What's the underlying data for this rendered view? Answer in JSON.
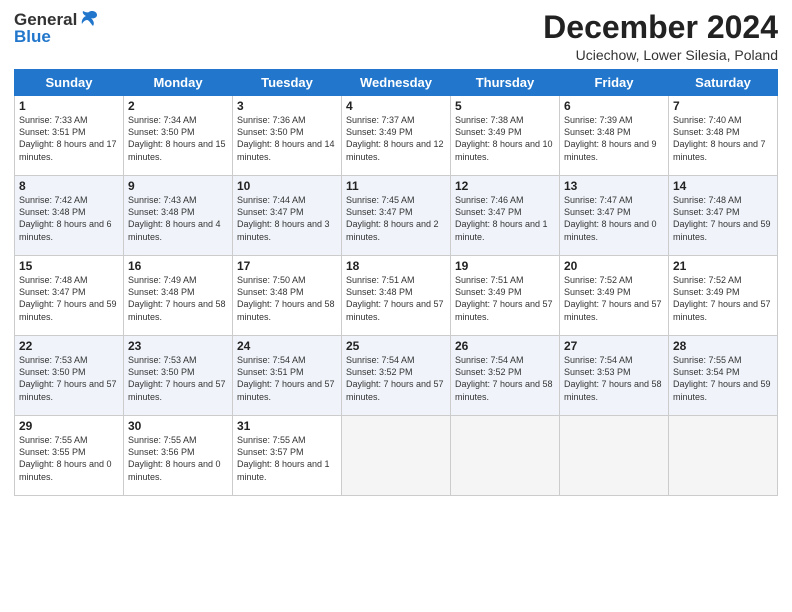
{
  "header": {
    "logo_general": "General",
    "logo_blue": "Blue",
    "month_title": "December 2024",
    "location": "Uciechow, Lower Silesia, Poland"
  },
  "weekdays": [
    "Sunday",
    "Monday",
    "Tuesday",
    "Wednesday",
    "Thursday",
    "Friday",
    "Saturday"
  ],
  "weeks": [
    [
      {
        "day": "1",
        "sunrise": "7:33 AM",
        "sunset": "3:51 PM",
        "daylight": "8 hours and 17 minutes."
      },
      {
        "day": "2",
        "sunrise": "7:34 AM",
        "sunset": "3:50 PM",
        "daylight": "8 hours and 15 minutes."
      },
      {
        "day": "3",
        "sunrise": "7:36 AM",
        "sunset": "3:50 PM",
        "daylight": "8 hours and 14 minutes."
      },
      {
        "day": "4",
        "sunrise": "7:37 AM",
        "sunset": "3:49 PM",
        "daylight": "8 hours and 12 minutes."
      },
      {
        "day": "5",
        "sunrise": "7:38 AM",
        "sunset": "3:49 PM",
        "daylight": "8 hours and 10 minutes."
      },
      {
        "day": "6",
        "sunrise": "7:39 AM",
        "sunset": "3:48 PM",
        "daylight": "8 hours and 9 minutes."
      },
      {
        "day": "7",
        "sunrise": "7:40 AM",
        "sunset": "3:48 PM",
        "daylight": "8 hours and 7 minutes."
      }
    ],
    [
      {
        "day": "8",
        "sunrise": "7:42 AM",
        "sunset": "3:48 PM",
        "daylight": "8 hours and 6 minutes."
      },
      {
        "day": "9",
        "sunrise": "7:43 AM",
        "sunset": "3:48 PM",
        "daylight": "8 hours and 4 minutes."
      },
      {
        "day": "10",
        "sunrise": "7:44 AM",
        "sunset": "3:47 PM",
        "daylight": "8 hours and 3 minutes."
      },
      {
        "day": "11",
        "sunrise": "7:45 AM",
        "sunset": "3:47 PM",
        "daylight": "8 hours and 2 minutes."
      },
      {
        "day": "12",
        "sunrise": "7:46 AM",
        "sunset": "3:47 PM",
        "daylight": "8 hours and 1 minute."
      },
      {
        "day": "13",
        "sunrise": "7:47 AM",
        "sunset": "3:47 PM",
        "daylight": "8 hours and 0 minutes."
      },
      {
        "day": "14",
        "sunrise": "7:48 AM",
        "sunset": "3:47 PM",
        "daylight": "7 hours and 59 minutes."
      }
    ],
    [
      {
        "day": "15",
        "sunrise": "7:48 AM",
        "sunset": "3:47 PM",
        "daylight": "7 hours and 59 minutes."
      },
      {
        "day": "16",
        "sunrise": "7:49 AM",
        "sunset": "3:48 PM",
        "daylight": "7 hours and 58 minutes."
      },
      {
        "day": "17",
        "sunrise": "7:50 AM",
        "sunset": "3:48 PM",
        "daylight": "7 hours and 58 minutes."
      },
      {
        "day": "18",
        "sunrise": "7:51 AM",
        "sunset": "3:48 PM",
        "daylight": "7 hours and 57 minutes."
      },
      {
        "day": "19",
        "sunrise": "7:51 AM",
        "sunset": "3:49 PM",
        "daylight": "7 hours and 57 minutes."
      },
      {
        "day": "20",
        "sunrise": "7:52 AM",
        "sunset": "3:49 PM",
        "daylight": "7 hours and 57 minutes."
      },
      {
        "day": "21",
        "sunrise": "7:52 AM",
        "sunset": "3:49 PM",
        "daylight": "7 hours and 57 minutes."
      }
    ],
    [
      {
        "day": "22",
        "sunrise": "7:53 AM",
        "sunset": "3:50 PM",
        "daylight": "7 hours and 57 minutes."
      },
      {
        "day": "23",
        "sunrise": "7:53 AM",
        "sunset": "3:50 PM",
        "daylight": "7 hours and 57 minutes."
      },
      {
        "day": "24",
        "sunrise": "7:54 AM",
        "sunset": "3:51 PM",
        "daylight": "7 hours and 57 minutes."
      },
      {
        "day": "25",
        "sunrise": "7:54 AM",
        "sunset": "3:52 PM",
        "daylight": "7 hours and 57 minutes."
      },
      {
        "day": "26",
        "sunrise": "7:54 AM",
        "sunset": "3:52 PM",
        "daylight": "7 hours and 58 minutes."
      },
      {
        "day": "27",
        "sunrise": "7:54 AM",
        "sunset": "3:53 PM",
        "daylight": "7 hours and 58 minutes."
      },
      {
        "day": "28",
        "sunrise": "7:55 AM",
        "sunset": "3:54 PM",
        "daylight": "7 hours and 59 minutes."
      }
    ],
    [
      {
        "day": "29",
        "sunrise": "7:55 AM",
        "sunset": "3:55 PM",
        "daylight": "8 hours and 0 minutes."
      },
      {
        "day": "30",
        "sunrise": "7:55 AM",
        "sunset": "3:56 PM",
        "daylight": "8 hours and 0 minutes."
      },
      {
        "day": "31",
        "sunrise": "7:55 AM",
        "sunset": "3:57 PM",
        "daylight": "8 hours and 1 minute."
      },
      null,
      null,
      null,
      null
    ]
  ]
}
